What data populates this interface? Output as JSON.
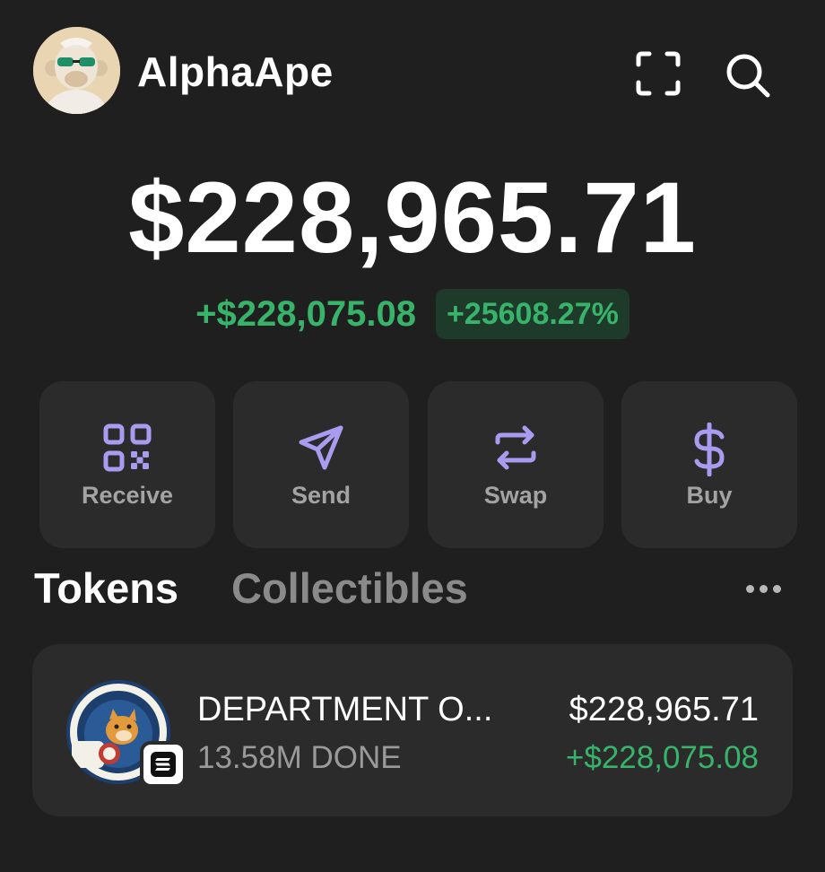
{
  "header": {
    "account_name": "AlphaApe",
    "avatar_icon": "ape-avatar-icon",
    "scan_icon": "scan-icon",
    "search_icon": "search-icon"
  },
  "balance": {
    "total": "$228,965.71",
    "change_amount": "+$228,075.08",
    "change_percent": "+25608.27%"
  },
  "actions": [
    {
      "label": "Receive",
      "icon": "qr-code-icon"
    },
    {
      "label": "Send",
      "icon": "send-arrow-icon"
    },
    {
      "label": "Swap",
      "icon": "swap-arrows-icon"
    },
    {
      "label": "Buy",
      "icon": "dollar-icon"
    }
  ],
  "tabs": {
    "active": "Tokens",
    "items": [
      {
        "label": "Tokens"
      },
      {
        "label": "Collectibles"
      }
    ]
  },
  "tokens": [
    {
      "name": "DEPARTMENT O...",
      "quantity": "13.58M DONE",
      "value": "$228,965.71",
      "change": "+$228,075.08",
      "logo_icon": "doge-department-logo-icon",
      "chain_icon": "solana-icon"
    }
  ],
  "colors": {
    "background": "#1f1f1f",
    "card": "#2b2b2b",
    "positive": "#37b46a",
    "accent_purple": "#a99cf0"
  }
}
